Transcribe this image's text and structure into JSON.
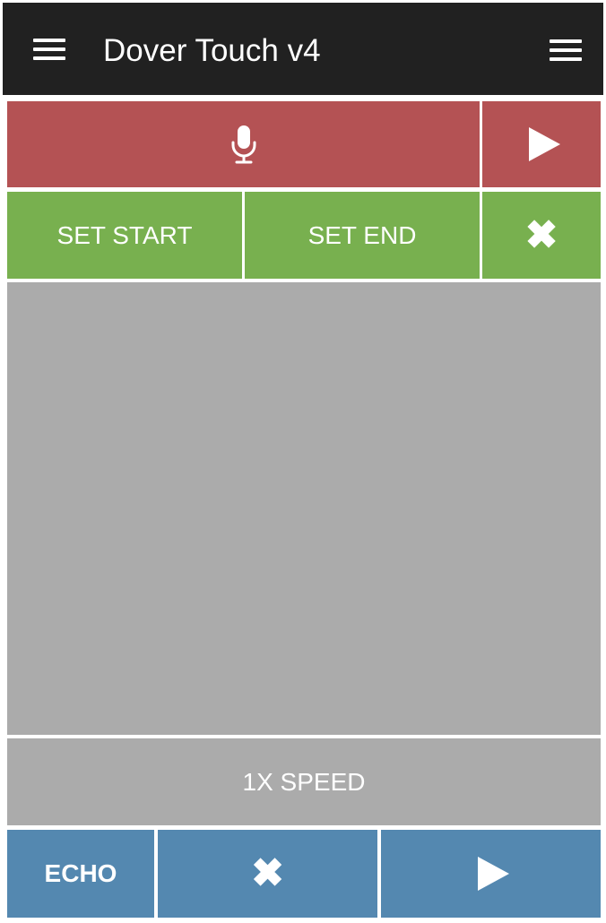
{
  "header": {
    "title": "Dover Touch v4",
    "left_menu_icon": "hamburger-icon",
    "right_menu_icon": "hamburger-icon"
  },
  "record_row": {
    "mic_icon": "microphone-icon",
    "play_icon": "play-icon"
  },
  "loop_row": {
    "set_start_label": "SET START",
    "set_end_label": "SET END",
    "clear_icon": "close-icon",
    "clear_glyph": "✖"
  },
  "speed": {
    "label": "1X SPEED"
  },
  "bottom_row": {
    "echo_label": "ECHO",
    "clear_icon": "close-icon",
    "clear_glyph": "✖",
    "play_icon": "play-icon"
  },
  "colors": {
    "header_bg": "#212121",
    "record_red": "#b45254",
    "loop_green": "#78b04f",
    "area_gray": "#ababab",
    "bottom_blue": "#5488b0"
  }
}
